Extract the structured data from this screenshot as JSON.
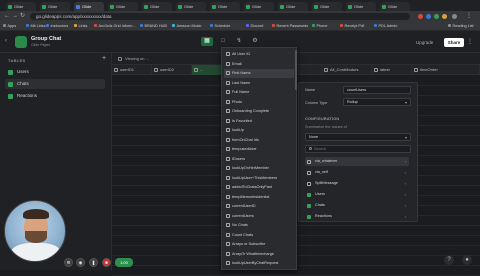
{
  "browser": {
    "tabs": [
      {
        "label": "Glide",
        "color": "#36a05a"
      },
      {
        "label": "Glide",
        "color": "#36a05a"
      },
      {
        "label": "Glide",
        "color": "#4a7bd6"
      },
      {
        "label": "Glide",
        "color": "#36a05a"
      },
      {
        "label": "Glide",
        "color": "#36a05a"
      },
      {
        "label": "Glide",
        "color": "#36a05a"
      },
      {
        "label": "Glide",
        "color": "#36a05a"
      },
      {
        "label": "Glide",
        "color": "#36a05a"
      },
      {
        "label": "Glide",
        "color": "#36a05a"
      },
      {
        "label": "Glide",
        "color": "#36a05a"
      },
      {
        "label": "Glide",
        "color": "#36a05a"
      },
      {
        "label": "Glide",
        "color": "#36a05a"
      }
    ],
    "url": "go.glideapps.com/app/xxxxxxxxx/data",
    "bookmarks": [
      {
        "label": "Apps",
        "color": "#888888"
      },
      {
        "label": "Mit Links",
        "color": "#3a78d8"
      },
      {
        "label": "Instructors",
        "color": "#3a78d8"
      },
      {
        "label": "Links",
        "color": "#d9a53a"
      },
      {
        "label": "ArcGrds Grid Inform...",
        "color": "#d84a3a"
      },
      {
        "label": "BRAND HUB",
        "color": "#3a78d8"
      },
      {
        "label": "Amazon Music",
        "color": "#3ab8d8"
      },
      {
        "label": "Schedule",
        "color": "#3a78d8"
      },
      {
        "label": "Discord",
        "color": "#5865f2"
      },
      {
        "label": "Recent Passwords",
        "color": "#d84a3a"
      },
      {
        "label": "Phone",
        "color": "#36a05a"
      },
      {
        "label": "Receipt Pdf",
        "color": "#d84a3a"
      },
      {
        "label": "PDL Admin",
        "color": "#3a78d8"
      },
      {
        "label": "Reading List",
        "color": "#888888"
      }
    ]
  },
  "app": {
    "title": "Group Chat",
    "subtitle": "Glide Pages",
    "upgrade_label": "Upgrade",
    "share_label": "Share"
  },
  "sidebar": {
    "section_title": "TABLES",
    "items": [
      {
        "label": "Users",
        "active": false
      },
      {
        "label": "Chats",
        "active": true
      },
      {
        "label": "Reactions",
        "active": false
      }
    ]
  },
  "toolbar": {
    "filter_label": "Viewing on ..."
  },
  "columns": [
    {
      "label": "userID1",
      "selected": false
    },
    {
      "label": "userID2",
      "selected": false
    },
    {
      "label": "...",
      "selected": true
    },
    {
      "label": "Email",
      "selected": false
    },
    {
      "label": "lastTime",
      "selected": false
    },
    {
      "label": "All_Contributors",
      "selected": false
    },
    {
      "label": "latest",
      "selected": false
    },
    {
      "label": "timeOrder",
      "selected": false
    }
  ],
  "dropdown": {
    "items": [
      "All User ID",
      "Email",
      "First Name",
      "Last Name",
      "Full Name",
      "Photo",
      "Onboarding Complete",
      "Is Favorited",
      "lookUp",
      "formOnChat Ids",
      "tempusedUser",
      "IDusers",
      "lookUpOnHerMember",
      "lookUpUser+ThisMembers",
      "addedToChatsOnlyPast",
      "tempMemoriesIdential",
      "currentUserID",
      "currentUsers",
      "No Chats",
      "Count Chats",
      "Arrays or Subscribe",
      "ArrayOr Whattimecharge",
      "lookUpUserByChatRequest"
    ],
    "highlighted_index": 2
  },
  "panel": {
    "name_label": "Name",
    "name_value": "countUsers",
    "type_label": "Column Type",
    "type_value": "Rollup",
    "section_title": "CONFIGURATION",
    "sub_label": "Summarize the values of",
    "source_value": "None",
    "search_placeholder": "Search",
    "rows": [
      {
        "label": "via_whatever",
        "selected": true,
        "green": false
      },
      {
        "label": "via_self",
        "selected": false,
        "green": false
      },
      {
        "label": "SplitMessage",
        "selected": false,
        "green": false
      },
      {
        "label": "Users",
        "selected": false,
        "green": true
      },
      {
        "label": "Chats",
        "selected": false,
        "green": true
      },
      {
        "label": "Reactions",
        "selected": false,
        "green": true
      }
    ]
  },
  "recorder": {
    "timer": "1:00"
  }
}
